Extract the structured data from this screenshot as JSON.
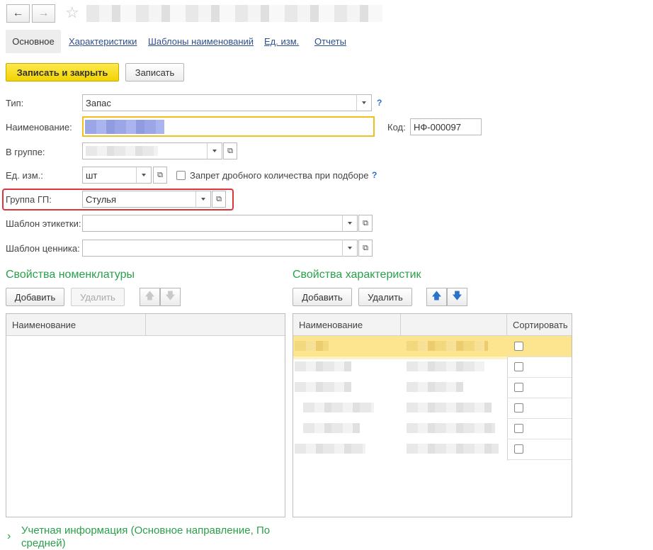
{
  "toolbar": {
    "back_icon": "←",
    "forward_icon": "→",
    "favorite_icon": "☆"
  },
  "tabs": [
    {
      "label": "Основное"
    },
    {
      "label": "Характеристики"
    },
    {
      "label": "Шаблоны наименований"
    },
    {
      "label": "Ед. изм."
    },
    {
      "label": "Отчеты"
    }
  ],
  "actions": {
    "save_close": "Записать и закрыть",
    "save": "Записать"
  },
  "form": {
    "type_label": "Тип:",
    "type_value": "Запас",
    "name_label": "Наименование:",
    "code_label": "Код:",
    "code_value": "НФ-000097",
    "group_label": "В группе:",
    "unit_label": "Ед. изм.:",
    "unit_value": "шт",
    "fractional_label": "Запрет дробного количества при подборе",
    "gp_group_label": "Группа ГП:",
    "gp_group_value": "Стулья",
    "label_template_label": "Шаблон этикетки:",
    "price_template_label": "Шаблон ценника:",
    "help": "?"
  },
  "nomenclature_props": {
    "title": "Свойства номенклатуры",
    "add": "Добавить",
    "delete": "Удалить",
    "col_name": "Наименование"
  },
  "characteristic_props": {
    "title": "Свойства характеристик",
    "add": "Добавить",
    "delete": "Удалить",
    "col_name": "Наименование",
    "col_sort": "Сортировать",
    "rows": [
      {
        "sort": false,
        "selected": true
      },
      {
        "sort": false,
        "selected": false
      },
      {
        "sort": false,
        "selected": false
      },
      {
        "sort": false,
        "selected": false
      },
      {
        "sort": false,
        "selected": false
      },
      {
        "sort": false,
        "selected": false
      }
    ]
  },
  "accounting": {
    "title_line1": "Учетная информация (Основное направление, По",
    "title_line2": "средней)"
  },
  "colors": {
    "accent_green": "#2aa04a",
    "primary_yellow": "#f2d300",
    "highlight_red": "#d9373b",
    "link_blue": "#2f4f8f"
  }
}
